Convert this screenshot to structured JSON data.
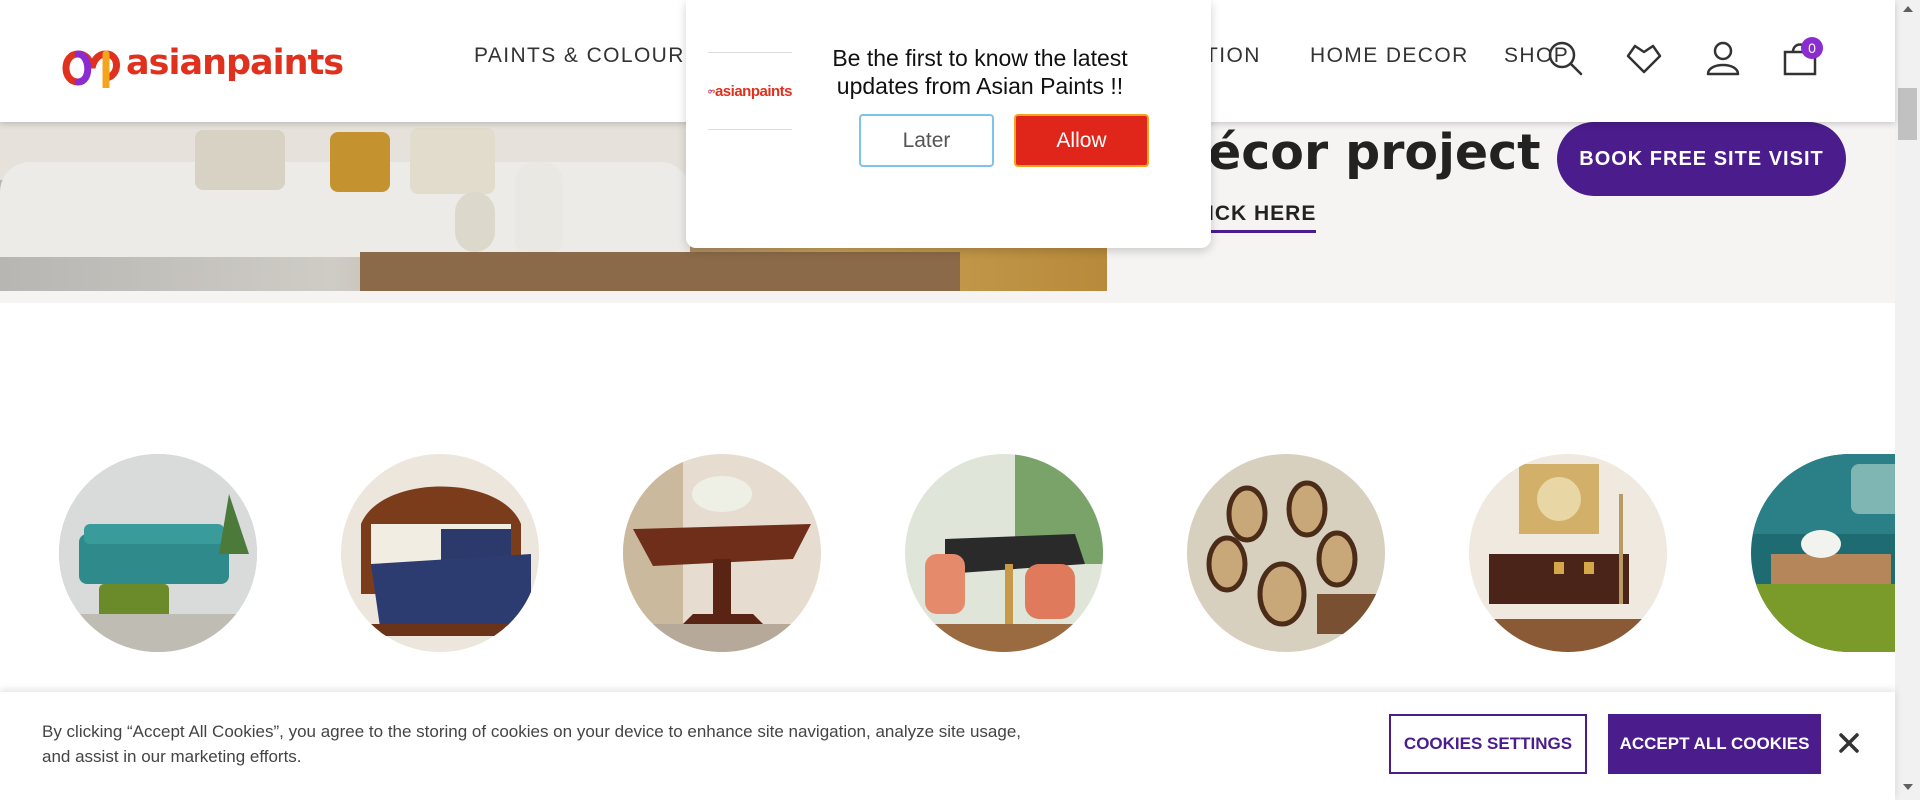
{
  "brand": {
    "name": "asianpaints",
    "color": "#e0311e",
    "accent": "#4b1c8c"
  },
  "nav": {
    "items": [
      {
        "label": "PAINTS & COLOURS"
      },
      {
        "label": "TION"
      },
      {
        "label": "HOME DECOR"
      },
      {
        "label": "SHOP"
      }
    ]
  },
  "header_icons": {
    "search": "search-icon",
    "wishlist": "heart-icon",
    "account": "user-icon",
    "cart": "cart-icon",
    "cart_count": "0"
  },
  "hero": {
    "title": "écor project",
    "link": "ICK HERE",
    "button": "BOOK FREE SITE VISIT"
  },
  "categories": [
    {
      "icon": "sofa-image"
    },
    {
      "icon": "bed-image"
    },
    {
      "icon": "table-image"
    },
    {
      "icon": "dining-set-image"
    },
    {
      "icon": "chairs-image"
    },
    {
      "icon": "sideboard-image"
    },
    {
      "icon": "sectional-image"
    }
  ],
  "notification": {
    "logo_text": "asianpaints",
    "message": "Be the first to know the latest updates from Asian Paints !!",
    "later": "Later",
    "allow": "Allow"
  },
  "cookie": {
    "text": "By clicking “Accept All Cookies”, you agree to the storing of cookies on your device to enhance site navigation, analyze site usage, and assist in our marketing efforts.",
    "settings": "COOKIES SETTINGS",
    "accept": "ACCEPT ALL COOKIES"
  }
}
